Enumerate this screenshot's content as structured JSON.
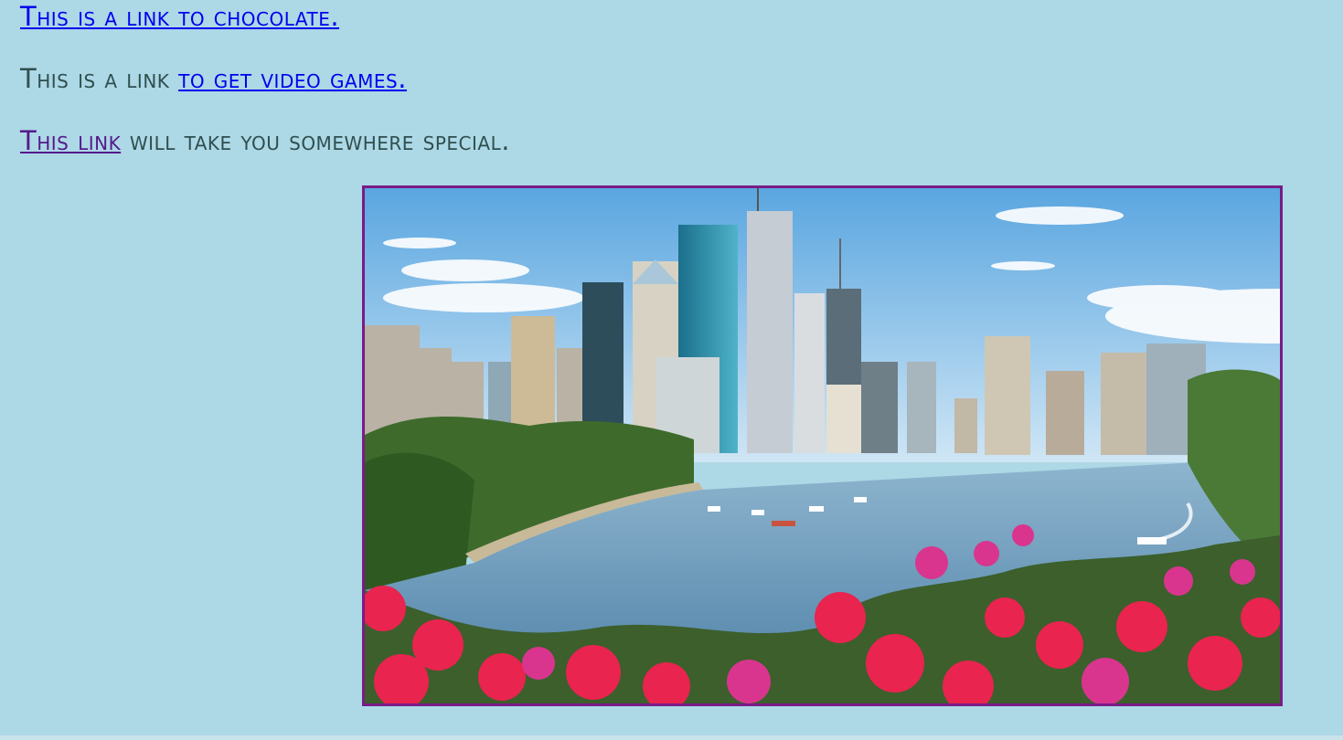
{
  "links": {
    "line1": {
      "link_text": "This is a link to chocolate."
    },
    "line2": {
      "prefix": "This is a link ",
      "link_text": "to get video games."
    },
    "line3": {
      "link_text": "This link",
      "suffix": " will take you somewhere special."
    }
  },
  "image": {
    "subject": "city skyline across a river with pink flowers in the foreground",
    "border_color": "#7a1b86"
  },
  "colors": {
    "background": "#add8e6",
    "text": "#2f4f4f",
    "link_unvisited": "#0000ee",
    "link_visited": "#551a8b"
  }
}
